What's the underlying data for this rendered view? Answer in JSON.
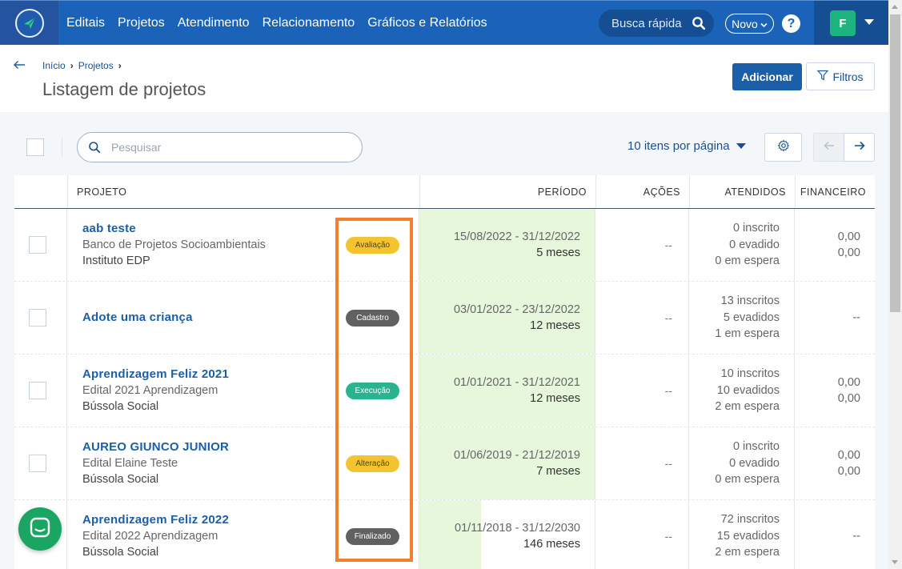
{
  "nav": {
    "items": [
      "Editais",
      "Projetos",
      "Atendimento",
      "Relacionamento",
      "Gráficos e Relatórios"
    ],
    "quick_search": "Busca rápida",
    "novo": "Novo",
    "help": "?",
    "user_initial": "F"
  },
  "breadcrumb": [
    "Início",
    "Projetos"
  ],
  "page_title": "Listagem de projetos",
  "buttons": {
    "add": "Adicionar",
    "filters": "Filtros"
  },
  "toolbar": {
    "search_placeholder": "Pesquisar",
    "per_page": "10 itens por página"
  },
  "table": {
    "headers": [
      "PROJETO",
      "PERÍODO",
      "AÇÕES",
      "ATENDIDOS",
      "FINANCEIRO"
    ],
    "rows": [
      {
        "name": "aab teste",
        "subtitle": "Banco de Projetos Socioambientais",
        "org": "Instituto EDP",
        "status": "Avaliação",
        "status_bg": "#f4c430",
        "status_fg": "#5a4400",
        "period": "15/08/2022 - 31/12/2022",
        "duration": "5 meses",
        "acoes": "--",
        "inscritos": "0 inscrito",
        "evadidos": "0 evadido",
        "espera": "0 em espera",
        "fin1": "0,00",
        "fin2": "0,00"
      },
      {
        "name": "Adote uma criança",
        "subtitle": "",
        "org": "",
        "status": "Cadastro",
        "status_bg": "#616161",
        "status_fg": "#ffffff",
        "period": "03/01/2022 - 23/12/2022",
        "duration": "12 meses",
        "acoes": "--",
        "inscritos": "13 inscritos",
        "evadidos": "5 evadidos",
        "espera": "1 em espera",
        "fin1": "--",
        "fin2": ""
      },
      {
        "name": "Aprendizagem Feliz 2021",
        "subtitle": "Edital 2021 Aprendizagem",
        "org": "Bússola Social",
        "status": "Execução",
        "status_bg": "#2ab38f",
        "status_fg": "#ffffff",
        "period": "01/01/2021 - 31/12/2021",
        "duration": "12 meses",
        "acoes": "--",
        "inscritos": "10 inscritos",
        "evadidos": "10 evadidos",
        "espera": "2 em espera",
        "fin1": "0,00",
        "fin2": "0,00"
      },
      {
        "name": "AUREO GIUNCO JUNIOR",
        "subtitle": "Edital Elaine Teste",
        "org": "Bússola Social",
        "status": "Alteração",
        "status_bg": "#f4c430",
        "status_fg": "#5a4400",
        "period": "01/06/2019 - 21/12/2019",
        "duration": "7 meses",
        "acoes": "--",
        "inscritos": "0 inscrito",
        "evadidos": "0 evadido",
        "espera": "0 em espera",
        "fin1": "0,00",
        "fin2": "0,00"
      },
      {
        "name": "Aprendizagem Feliz 2022",
        "subtitle": "Edital 2022 Aprendizagem",
        "org": "Bússola Social",
        "status": "Finalizado",
        "status_bg": "#616161",
        "status_fg": "#ffffff",
        "period": "01/11/2018 - 31/12/2030",
        "duration": "146 meses",
        "acoes": "--",
        "inscritos": "72 inscritos",
        "evadidos": "15 evadidos",
        "espera": "2 em espera",
        "fin1": "--",
        "fin2": ""
      }
    ]
  },
  "colors": {
    "topbar": "#1a63b8",
    "primary": "#1a5fa8",
    "period_bg": "#e6f7dc",
    "highlight": "#f07f2f",
    "chat": "#1aa563"
  },
  "icons": [
    "logo-icon",
    "search-icon",
    "chevron-down-icon",
    "help-icon",
    "back-arrow-icon",
    "filter-icon",
    "gear-icon",
    "arrow-left-icon",
    "arrow-right-icon",
    "chat-icon"
  ]
}
